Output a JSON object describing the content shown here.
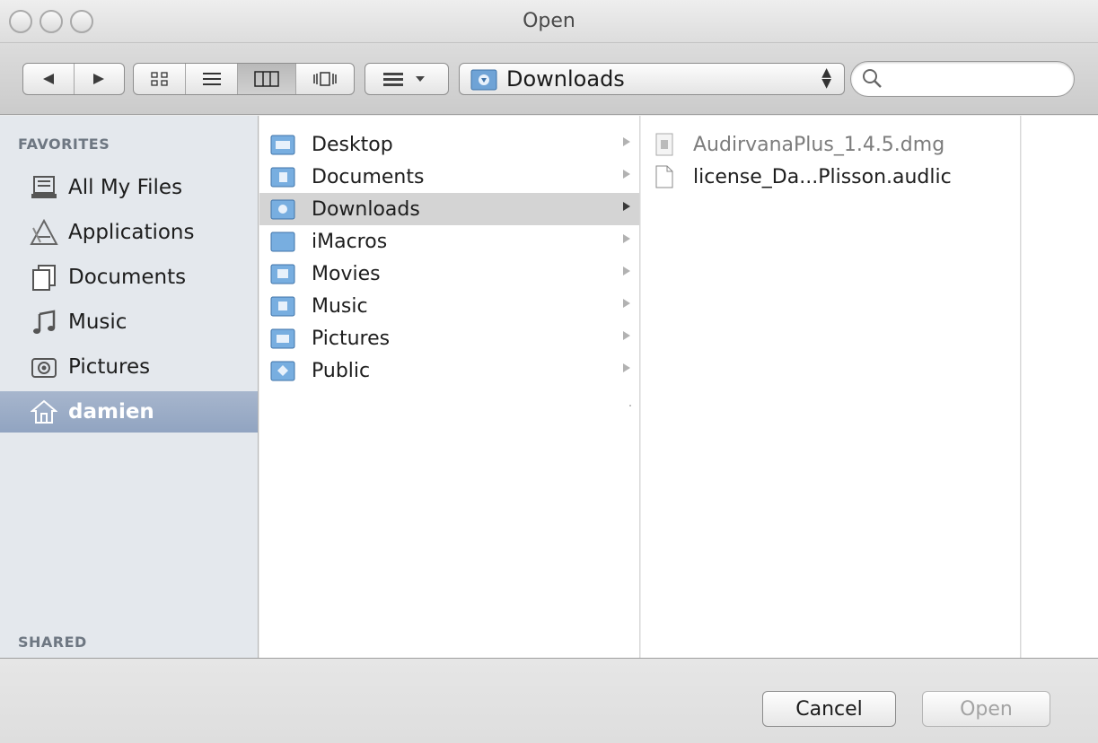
{
  "window": {
    "title": "Open"
  },
  "toolbar": {
    "location": "Downloads",
    "search_placeholder": ""
  },
  "sidebar": {
    "favorites_header": "FAVORITES",
    "shared_header": "SHARED",
    "items": [
      {
        "label": "All My Files",
        "icon": "all-files-icon"
      },
      {
        "label": "Applications",
        "icon": "applications-icon"
      },
      {
        "label": "Documents",
        "icon": "documents-icon"
      },
      {
        "label": "Music",
        "icon": "music-note-icon"
      },
      {
        "label": "Pictures",
        "icon": "camera-icon"
      },
      {
        "label": "damien",
        "icon": "home-icon",
        "selected": true
      }
    ]
  },
  "column1": {
    "items": [
      {
        "label": "Desktop"
      },
      {
        "label": "Documents"
      },
      {
        "label": "Downloads",
        "selected": true
      },
      {
        "label": "iMacros"
      },
      {
        "label": "Movies"
      },
      {
        "label": "Music"
      },
      {
        "label": "Pictures"
      },
      {
        "label": "Public"
      }
    ]
  },
  "column2": {
    "items": [
      {
        "label": "AudirvanaPlus_1.4.5.dmg",
        "disabled": true
      },
      {
        "label": "license_Da...Plisson.audlic"
      }
    ]
  },
  "buttons": {
    "cancel": "Cancel",
    "open": "Open"
  },
  "colors": {
    "sidebar_selected": "#9aabc6",
    "folder_blue": "#6fa3d6",
    "row_selected": "#d4d4d4"
  }
}
